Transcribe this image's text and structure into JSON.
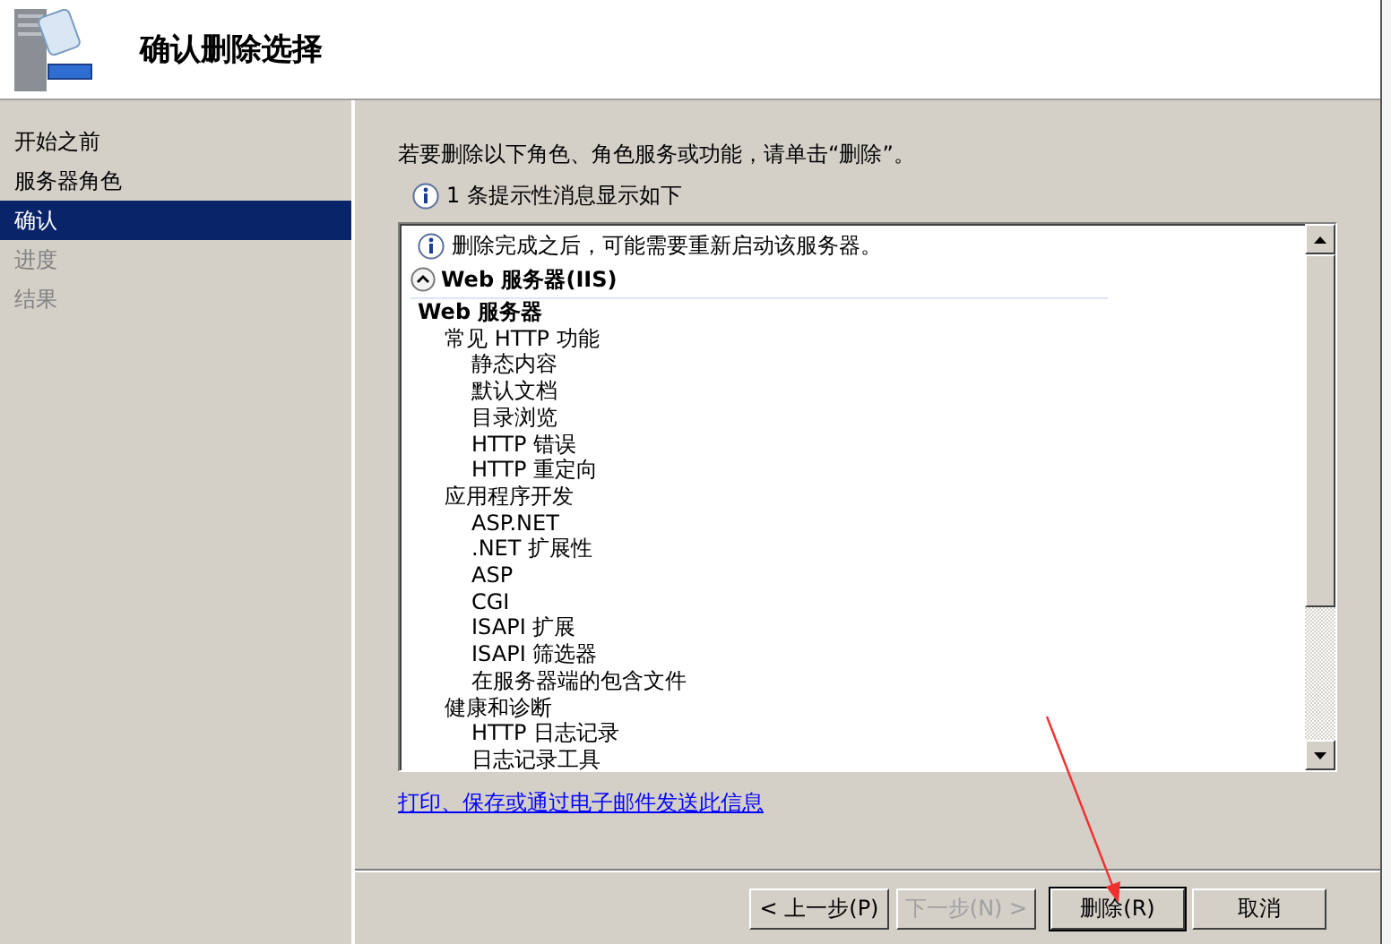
{
  "header": {
    "title": "确认删除选择"
  },
  "nav": [
    {
      "label": "开始之前",
      "selected": false,
      "disabled": false
    },
    {
      "label": "服务器角色",
      "selected": false,
      "disabled": false
    },
    {
      "label": "确认",
      "selected": true,
      "disabled": false
    },
    {
      "label": "进度",
      "selected": false,
      "disabled": true
    },
    {
      "label": "结果",
      "selected": false,
      "disabled": true
    }
  ],
  "instructions": "若要删除以下角色、角色服务或功能，请单击“删除”。",
  "info_summary": "1 条提示性消息显示如下",
  "details": {
    "notice": "删除完成之后，可能需要重新启动该服务器。",
    "section": {
      "title": "Web 服务器(IIS)",
      "expanded": true,
      "items": [
        {
          "label": "Web 服务器",
          "children": [
            {
              "label": "常见 HTTP 功能",
              "children": [
                {
                  "label": "静态内容"
                },
                {
                  "label": "默认文档"
                },
                {
                  "label": "目录浏览"
                },
                {
                  "label": "HTTP 错误"
                },
                {
                  "label": "HTTP 重定向"
                }
              ]
            },
            {
              "label": "应用程序开发",
              "children": [
                {
                  "label": "ASP.NET"
                },
                {
                  "label": ".NET 扩展性"
                },
                {
                  "label": "ASP"
                },
                {
                  "label": "CGI"
                },
                {
                  "label": "ISAPI 扩展"
                },
                {
                  "label": "ISAPI 筛选器"
                },
                {
                  "label": "在服务器端的包含文件"
                }
              ]
            },
            {
              "label": "健康和诊断",
              "children": [
                {
                  "label": "HTTP 日志记录"
                },
                {
                  "label": "日志记录工具"
                }
              ]
            }
          ]
        }
      ]
    }
  },
  "link": "打印、保存或通过电子邮件发送此信息",
  "buttons": [
    {
      "label": "< 上一步(P)",
      "disabled": false,
      "default": false
    },
    {
      "label": "下一步(N) >",
      "disabled": true,
      "default": false
    },
    {
      "label": "删除(R)",
      "disabled": false,
      "default": true
    },
    {
      "label": "取消",
      "disabled": false,
      "default": false
    }
  ]
}
